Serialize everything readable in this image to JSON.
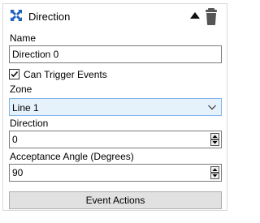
{
  "header": {
    "title": "Direction",
    "icon": "move-arrows-icon"
  },
  "name_field": {
    "label": "Name",
    "value": "Direction 0"
  },
  "can_trigger": {
    "label": "Can Trigger Events",
    "checked": true
  },
  "zone": {
    "label": "Zone",
    "selected": "Line 1"
  },
  "direction": {
    "label": "Direction",
    "value": "0"
  },
  "acceptance": {
    "label": "Acceptance Angle (Degrees)",
    "value": "90"
  },
  "event_button": {
    "label": "Event Actions"
  },
  "colors": {
    "accent": "#1e5fbf",
    "select_bg": "#e5f1fb",
    "select_border": "#7eb4ea"
  }
}
